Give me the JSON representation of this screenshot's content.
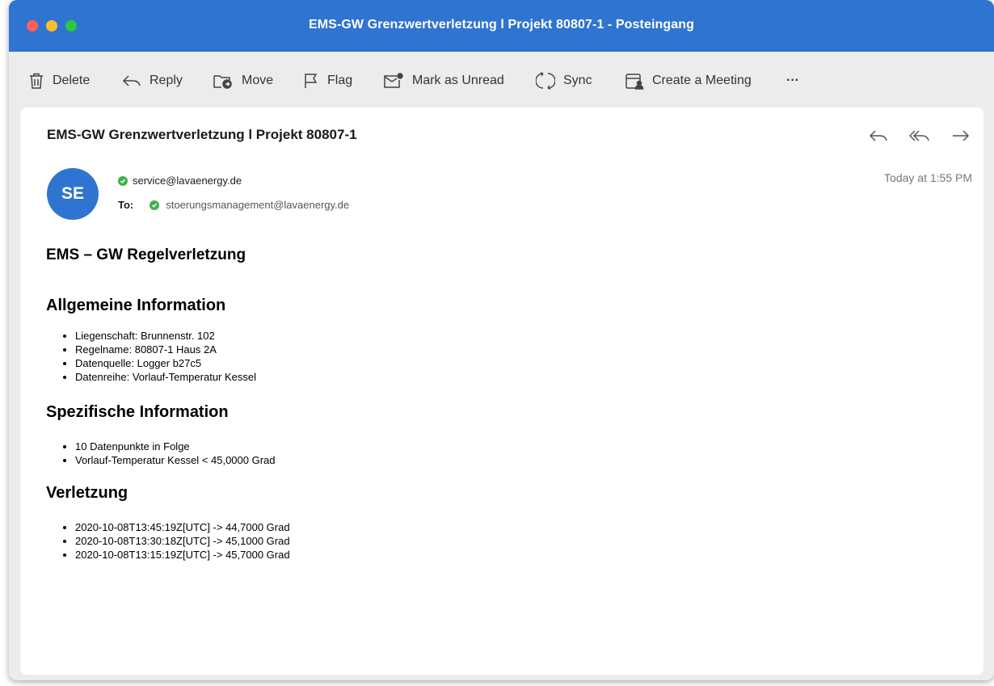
{
  "window": {
    "title": "EMS-GW Grenzwertverletzung l Projekt 80807-1  - Posteingang"
  },
  "toolbar": {
    "delete": "Delete",
    "reply": "Reply",
    "move": "Move",
    "flag": "Flag",
    "mark_unread": "Mark as Unread",
    "sync": "Sync",
    "create_meeting": "Create a Meeting",
    "more": "···"
  },
  "message": {
    "subject": "EMS-GW Grenzwertverletzung l Projekt 80807-1",
    "avatar_initials": "SE",
    "from": "service@lavaenergy.de",
    "to_label": "To:",
    "to": "stoerungsmanagement@lavaenergy.de",
    "date": "Today at 1:55 PM"
  },
  "body": {
    "heading": "EMS – GW Regelverletzung",
    "sections": [
      {
        "title": "Allgemeine Information",
        "items": [
          "Liegenschaft: Brunnenstr. 102",
          "Regelname: 80807-1 Haus 2A",
          "Datenquelle: Logger b27c5",
          "Datenreihe: Vorlauf-Temperatur Kessel"
        ]
      },
      {
        "title": "Spezifische Information",
        "items": [
          "10 Datenpunkte in Folge",
          "Vorlauf-Temperatur Kessel < 45,0000 Grad"
        ]
      },
      {
        "title": "Verletzung",
        "items": [
          "2020-10-08T13:45:19Z[UTC] -> 44,7000 Grad",
          "2020-10-08T13:30:18Z[UTC] -> 45,1000 Grad",
          "2020-10-08T13:15:19Z[UTC] -> 45,7000 Grad"
        ]
      }
    ]
  },
  "colors": {
    "titlebar": "#2f74d0",
    "avatar": "#2f74d0",
    "verified": "#3fb24c"
  }
}
